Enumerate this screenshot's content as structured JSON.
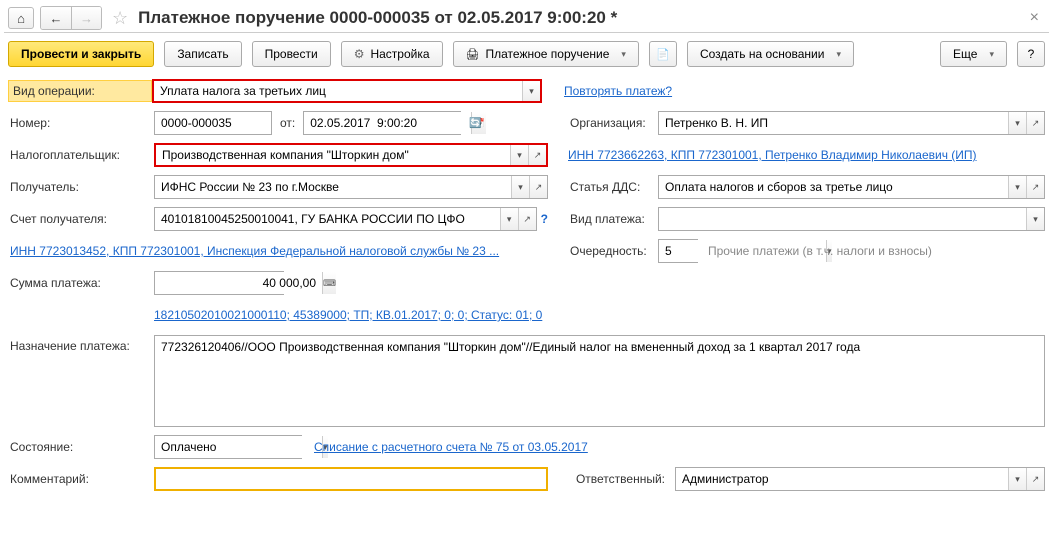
{
  "header": {
    "title": "Платежное поручение 0000-000035 от 02.05.2017 9:00:20 *"
  },
  "toolbar": {
    "post_close": "Провести и закрыть",
    "save": "Записать",
    "post": "Провести",
    "settings": "Настройка",
    "payment_order": "Платежное поручение",
    "create_based": "Создать на основании",
    "more": "Еще",
    "help": "?"
  },
  "labels": {
    "operation": "Вид операции:",
    "number": "Номер:",
    "from": "от:",
    "taxpayer": "Налогоплательщик:",
    "recipient": "Получатель:",
    "recipient_acc": "Счет получателя:",
    "amount": "Сумма платежа:",
    "purpose": "Назначение платежа:",
    "state": "Состояние:",
    "comment": "Комментарий:",
    "org": "Организация:",
    "dds": "Статья ДДС:",
    "ptype": "Вид платежа:",
    "priority": "Очередность:",
    "priority_hint": "Прочие платежи (в т.ч. налоги и взносы)",
    "responsible": "Ответственный:"
  },
  "values": {
    "operation": "Уплата налога за третьих лиц",
    "number": "0000-000035",
    "date": "02.05.2017  9:00:20",
    "taxpayer": "Производственная компания \"Шторкин дом\"",
    "recipient": "ИФНС России № 23 по г.Москве",
    "recipient_acc": "40101810045250010041, ГУ БАНКА РОССИИ ПО ЦФО",
    "amount": "40 000,00",
    "purpose": "772326120406//ООО Производственная компания \"Шторкин дом\"//Единый налог на вмененный доход за 1 квартал 2017 года",
    "state": "Оплачено",
    "comment": "",
    "org": "Петренко В. Н. ИП",
    "dds": "Оплата налогов и сборов за третье лицо",
    "ptype": "",
    "priority": "5",
    "responsible": "Администратор"
  },
  "links": {
    "repeat": "Повторять платеж?",
    "taxpayer_info": "ИНН 7723662263, КПП 772301001, Петренко Владимир Николаевич (ИП)",
    "recipient_info": "ИНН 7723013452, КПП 772301001, Инспекция Федеральной налоговой службы № 23 ...",
    "kbk": "18210502010021000110; 45389000; ТП; КВ.01.2017; 0; 0; Статус: 01; 0",
    "writeoff": "Списание с расчетного счета № 75 от 03.05.2017"
  }
}
